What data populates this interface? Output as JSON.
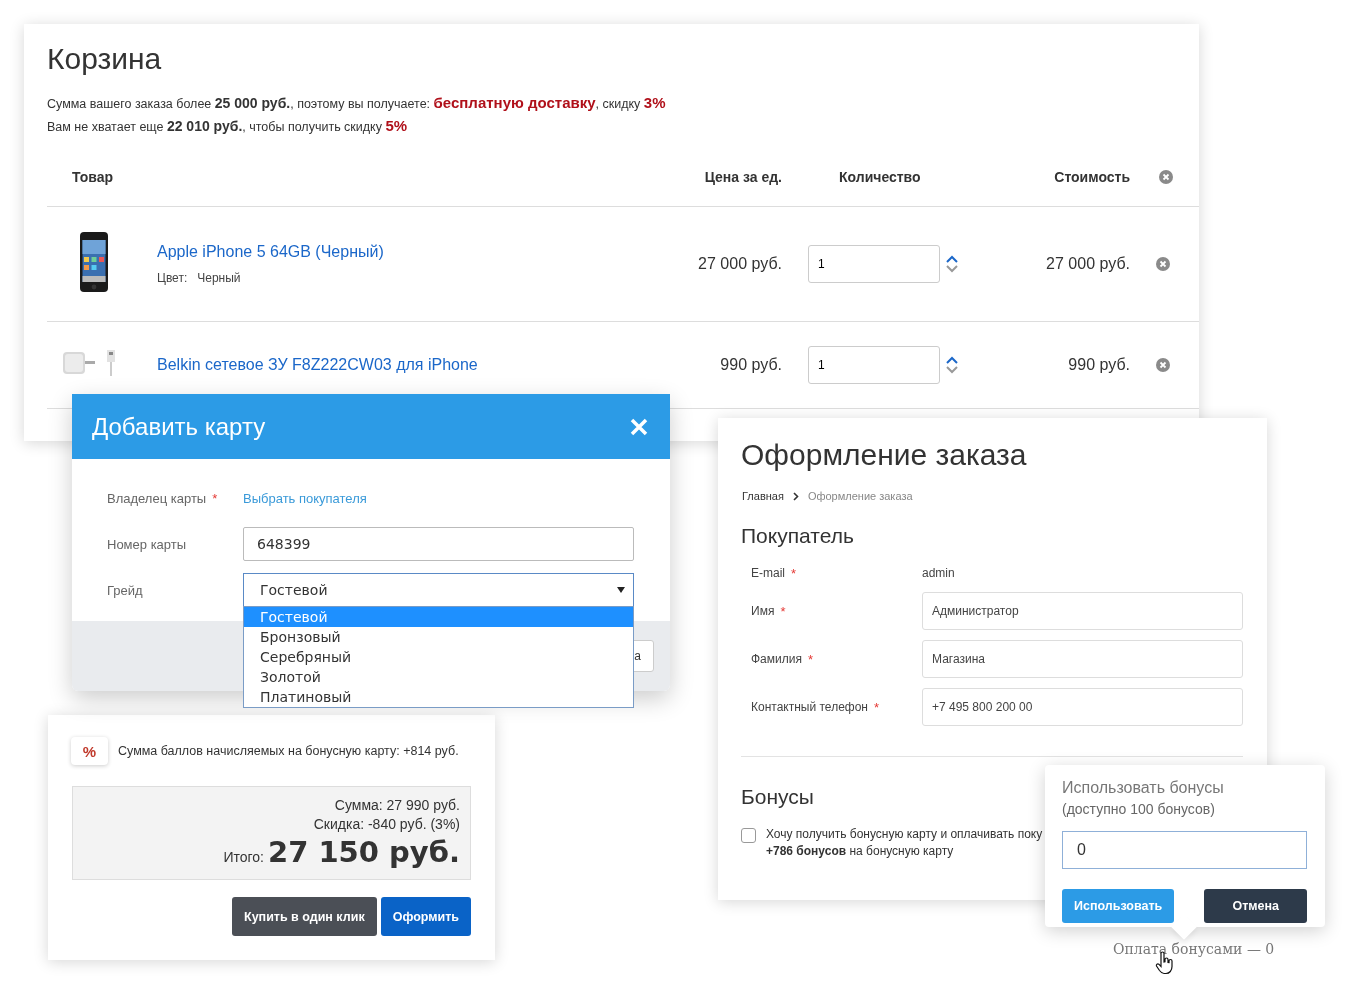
{
  "cart": {
    "title": "Корзина",
    "notices": [
      [
        {
          "kind": "plain",
          "text": "Сумма вашего заказа более "
        },
        {
          "kind": "strong",
          "text": "25 000 руб."
        },
        {
          "kind": "plain",
          "text": ", поэтому вы получаете: "
        },
        {
          "kind": "accent",
          "text": "бесплатную доставку"
        },
        {
          "kind": "plain",
          "text": ", скидку "
        },
        {
          "kind": "accent",
          "text": "3%"
        }
      ],
      [
        {
          "kind": "plain",
          "text": "Вам не хватает еще "
        },
        {
          "kind": "strong",
          "text": "22 010 руб."
        },
        {
          "kind": "plain",
          "text": ", чтобы получить скидку "
        },
        {
          "kind": "accent",
          "text": "5%"
        }
      ]
    ],
    "columns": [
      "Товар",
      "Цена за ед.",
      "Количество",
      "Стоимость"
    ],
    "items": [
      {
        "kind": "phone",
        "name": "Apple iPhone 5 64GB (Черный)",
        "attribute": {
          "label": "Цвет:",
          "value": "Черный"
        },
        "price": "27 000 руб.",
        "quantity": "1",
        "cost": "27 000 руб."
      },
      {
        "kind": "charger",
        "name": "Belkin сетевое ЗУ F8Z222CW03 для iPhone",
        "price": "990 руб.",
        "quantity": "1",
        "cost": "990 руб."
      }
    ]
  },
  "add_card_dialog": {
    "title": "Добавить карту",
    "fields": [
      {
        "kind": "link",
        "label": "Владелец карты",
        "required_mark": "*",
        "value": "Выбрать покупателя"
      },
      {
        "kind": "input",
        "label": "Номер карты",
        "value": "648399"
      },
      {
        "kind": "select",
        "label": "Грейд",
        "value": "Гостевой",
        "options": [
          {
            "label": "Гостевой",
            "selected": true
          },
          {
            "label": "Бронзовый",
            "selected": false
          },
          {
            "label": "Серебряный",
            "selected": false
          },
          {
            "label": "Золотой",
            "selected": false
          },
          {
            "label": "Платиновый",
            "selected": false
          }
        ]
      }
    ],
    "footer_button": "а"
  },
  "bonus_summary": {
    "badge": "%",
    "points_text": "Сумма баллов начисляемых на бонусную карту: +814 руб.",
    "sum": "Сумма: 27 990 руб.",
    "discount": "Скидка: -840 руб. (3%)",
    "total_label": "Итого:",
    "total": "27 150 руб.",
    "buttons": [
      {
        "kind": "dark",
        "label": "Купить в один клик"
      },
      {
        "kind": "primary",
        "label": "Оформить"
      }
    ]
  },
  "checkout": {
    "title": "Оформление заказа",
    "breadcrumbs": [
      "Главная",
      "Оформление заказа"
    ],
    "section": "Покупатель",
    "fields": [
      {
        "kind": "text",
        "label": "E-mail",
        "required_mark": "*",
        "value": "admin"
      },
      {
        "kind": "input",
        "label": "Имя",
        "required_mark": "*",
        "value": "Администратор"
      },
      {
        "kind": "input",
        "label": "Фамилия",
        "required_mark": "*",
        "value": "Магазина"
      },
      {
        "kind": "input",
        "label": "Контактный телефон",
        "required_mark": "*",
        "value": "+7 495 800 200 00"
      }
    ],
    "bonuses": {
      "title": "Бонусы",
      "checked": false,
      "text": "Хочу получить бонусную карту и оплачивать поку",
      "note": "**+786 бонусов** на бонусную карту"
    }
  },
  "bonus_popover": {
    "title": "Использовать бонусы",
    "subtitle": "(доступно 100 бонусов)",
    "value": "0",
    "buttons": [
      {
        "kind": "primary",
        "label": "Использовать"
      },
      {
        "kind": "dark",
        "label": "Отмена"
      }
    ],
    "link": "Оплата бонусами — 0"
  }
}
